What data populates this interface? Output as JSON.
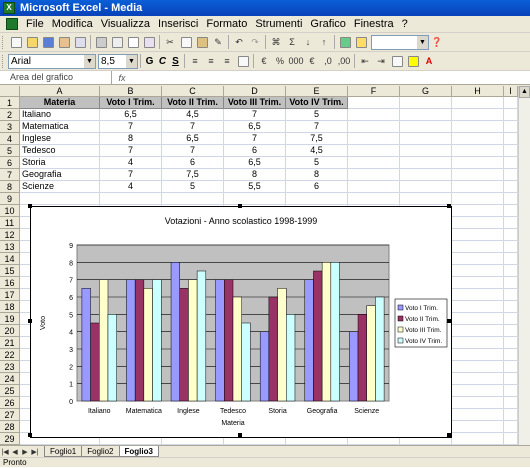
{
  "window": {
    "title": "Microsoft Excel - Media"
  },
  "menu": [
    "File",
    "Modifica",
    "Visualizza",
    "Inserisci",
    "Formato",
    "Strumenti",
    "Grafico",
    "Finestra",
    "?"
  ],
  "format_toolbar": {
    "font": "Arial",
    "size": "8,5",
    "bold": "G",
    "italic": "C",
    "underline": "S"
  },
  "formula_bar": {
    "name_box": "Area del grafico",
    "fx": "fx",
    "content": ""
  },
  "columns": [
    "A",
    "B",
    "C",
    "D",
    "E",
    "F",
    "G",
    "H",
    "I"
  ],
  "rows": [
    "1",
    "2",
    "3",
    "4",
    "5",
    "6",
    "7",
    "8",
    "9",
    "10",
    "11",
    "12",
    "13",
    "14",
    "15",
    "16",
    "17",
    "18",
    "19",
    "20",
    "21",
    "22",
    "23",
    "24",
    "25",
    "26",
    "27",
    "28",
    "29"
  ],
  "table": {
    "headers": [
      "Materia",
      "Voto I Trim.",
      "Voto II Trim.",
      "Voto III Trim.",
      "Voto IV Trim."
    ],
    "rows": [
      [
        "Italiano",
        "6,5",
        "4,5",
        "7",
        "5"
      ],
      [
        "Matematica",
        "7",
        "7",
        "6,5",
        "7"
      ],
      [
        "Inglese",
        "8",
        "6,5",
        "7",
        "7,5"
      ],
      [
        "Tedesco",
        "7",
        "7",
        "6",
        "4,5"
      ],
      [
        "Storia",
        "4",
        "6",
        "6,5",
        "5"
      ],
      [
        "Geografia",
        "7",
        "7,5",
        "8",
        "8"
      ],
      [
        "Scienze",
        "4",
        "5",
        "5,5",
        "6"
      ]
    ]
  },
  "sheet_tabs": [
    "Foglio1",
    "Foglio2",
    "Foglio3"
  ],
  "active_tab": "Foglio3",
  "status": "Pronto",
  "chart_data": {
    "type": "bar",
    "title": "Votazioni - Anno scolastico 1998-1999",
    "xlabel": "Materia",
    "ylabel": "Voto",
    "ylim": [
      0,
      9
    ],
    "yticks": [
      "0",
      "1",
      "2",
      "3",
      "4",
      "5",
      "6",
      "7",
      "8",
      "9"
    ],
    "categories": [
      "Italiano",
      "Matematica",
      "Inglese",
      "Tedesco",
      "Storia",
      "Geografia",
      "Scienze"
    ],
    "series": [
      {
        "name": "Voto I Trim.",
        "color": "#9999ff",
        "values": [
          6.5,
          7,
          8,
          7,
          4,
          7,
          4
        ]
      },
      {
        "name": "Voto II Trim.",
        "color": "#993366",
        "values": [
          4.5,
          7,
          6.5,
          7,
          6,
          7.5,
          5
        ]
      },
      {
        "name": "Voto III Trim.",
        "color": "#ffffcc",
        "values": [
          7,
          6.5,
          7,
          6,
          6.5,
          8,
          5.5
        ]
      },
      {
        "name": "Voto IV Trim.",
        "color": "#ccffff",
        "values": [
          5,
          7,
          7.5,
          4.5,
          5,
          8,
          6
        ]
      }
    ],
    "grid": true,
    "plot_background": "#c0c0c0",
    "legend_position": "right"
  }
}
